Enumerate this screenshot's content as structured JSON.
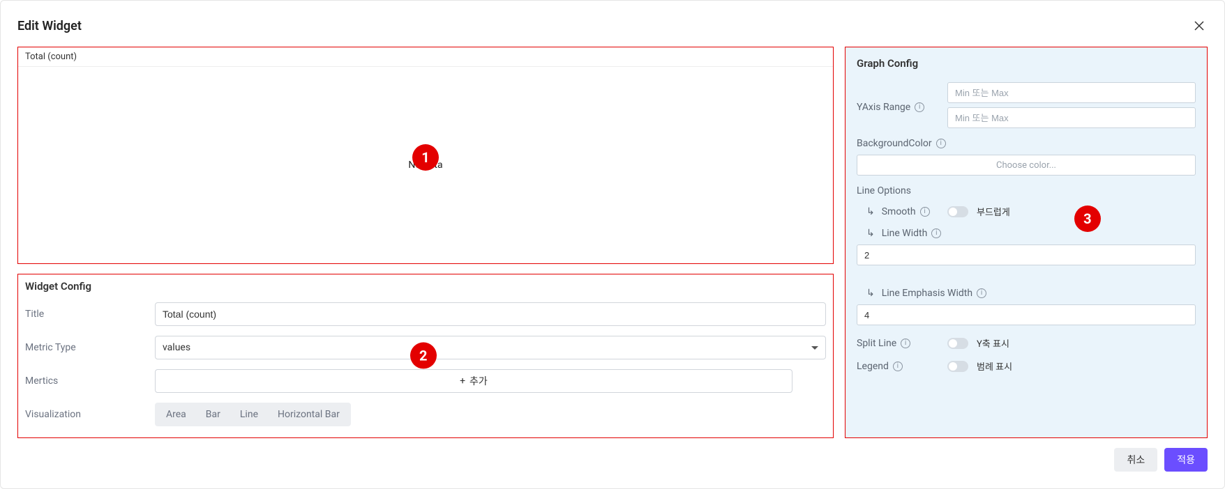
{
  "modal": {
    "title": "Edit Widget"
  },
  "preview": {
    "title": "Total (count)",
    "noData": "No data"
  },
  "widgetConfig": {
    "heading": "Widget Config",
    "titleLabel": "Title",
    "titleValue": "Total (count)",
    "metricTypeLabel": "Metric Type",
    "metricTypeValue": "values",
    "metricsLabel": "Mertics",
    "addLabel": "추가",
    "visualizationLabel": "Visualization",
    "vizOptions": [
      "Area",
      "Bar",
      "Line",
      "Horizontal Bar"
    ]
  },
  "graphConfig": {
    "heading": "Graph Config",
    "yaxisLabel": "YAxis Range",
    "yaxisPlaceholder1": "Min 또는 Max",
    "yaxisPlaceholder2": "Min 또는 Max",
    "bgColorLabel": "BackgroundColor",
    "bgColorPlaceholder": "Choose color...",
    "lineOptionsHeading": "Line Options",
    "smoothLabel": "Smooth",
    "smoothToggleLabel": "부드럽게",
    "lineWidthLabel": "Line Width",
    "lineWidthValue": "2",
    "lineEmphasisLabel": "Line Emphasis Width",
    "lineEmphasisValue": "4",
    "splitLineLabel": "Split Line",
    "splitLineToggleLabel": "Y축 표시",
    "legendLabel": "Legend",
    "legendToggleLabel": "범례 표시"
  },
  "badges": {
    "one": "1",
    "two": "2",
    "three": "3"
  },
  "footer": {
    "cancel": "취소",
    "apply": "적용"
  }
}
